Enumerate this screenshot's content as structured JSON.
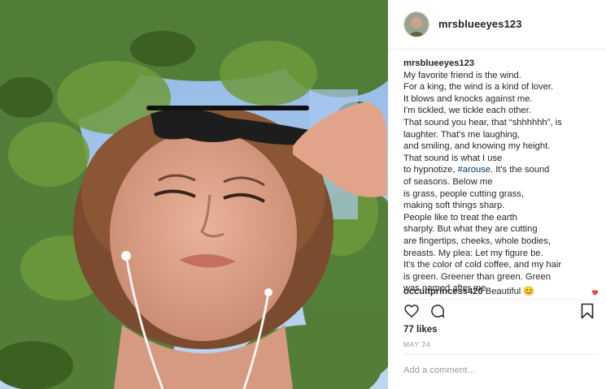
{
  "post": {
    "username": "mrsblueeyes123",
    "caption_user": "mrsblueeyes123",
    "caption_lines": [
      "My favorite friend is the wind.",
      "For a king, the wind is a kind of lover.",
      "It blows and knocks against me.",
      "I'm tickled, we tickle each other.",
      "That sound you hear, that “shhhhhh”, is",
      "laughter. That's me laughing,",
      "and smiling, and knowing my height.",
      "That sound is what I use"
    ],
    "hashtag_before": "to hypnotize, ",
    "hashtag": "#arouse",
    "hashtag_after": ". It's the sound",
    "caption_lines_2": [
      "of seasons. Below me",
      "is grass, people cutting grass,",
      "making soft things sharp.",
      "People like to treat the earth",
      "sharply. But what they are cutting",
      "are fingertips, cheeks, whole bodies,",
      "breasts. My plea: Let my figure be.",
      "It's the color of cold coffee, and my hair",
      "is green. Greener than green. Green",
      "was named after me."
    ],
    "comment_user": "occultprincess420",
    "comment_text": " Beautiful 😊",
    "likes": "77 likes",
    "date": "MAY 24",
    "add_comment_placeholder": "Add a comment..."
  },
  "colors": {
    "hashtag": "#003569",
    "like_red": "#ed4956",
    "muted": "#999999"
  },
  "icons": [
    "heart-icon",
    "comment-icon",
    "bookmark-icon"
  ]
}
